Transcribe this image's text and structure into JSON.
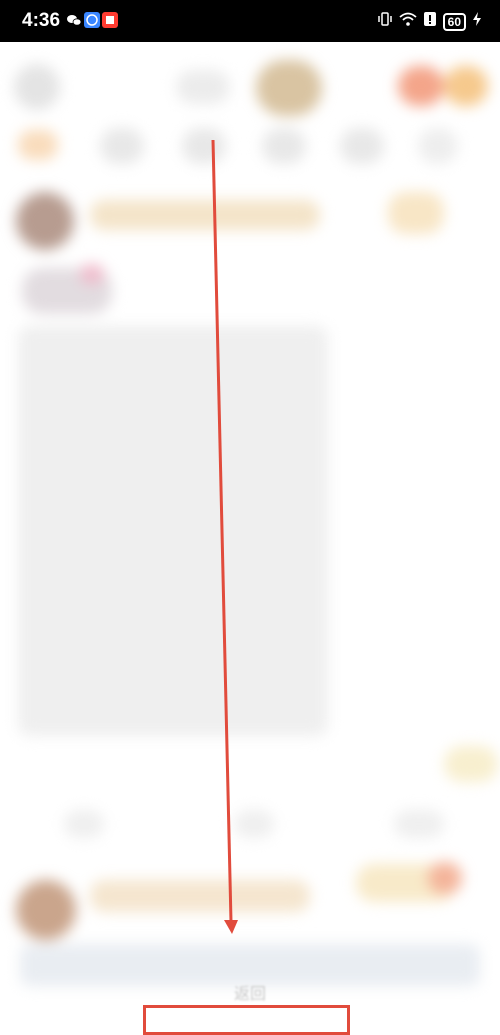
{
  "status_bar": {
    "time": "4:36",
    "battery": "60",
    "notification_icons": [
      "wechat-icon",
      "browser-icon",
      "app-notification-icon"
    ],
    "system_icons": [
      "vibrate-icon",
      "wifi-icon",
      "alert-icon",
      "battery-icon",
      "charging-icon"
    ]
  },
  "feed": {
    "bottom_bar_label": "返回"
  },
  "annotation": {
    "color": "#e14b3c"
  }
}
